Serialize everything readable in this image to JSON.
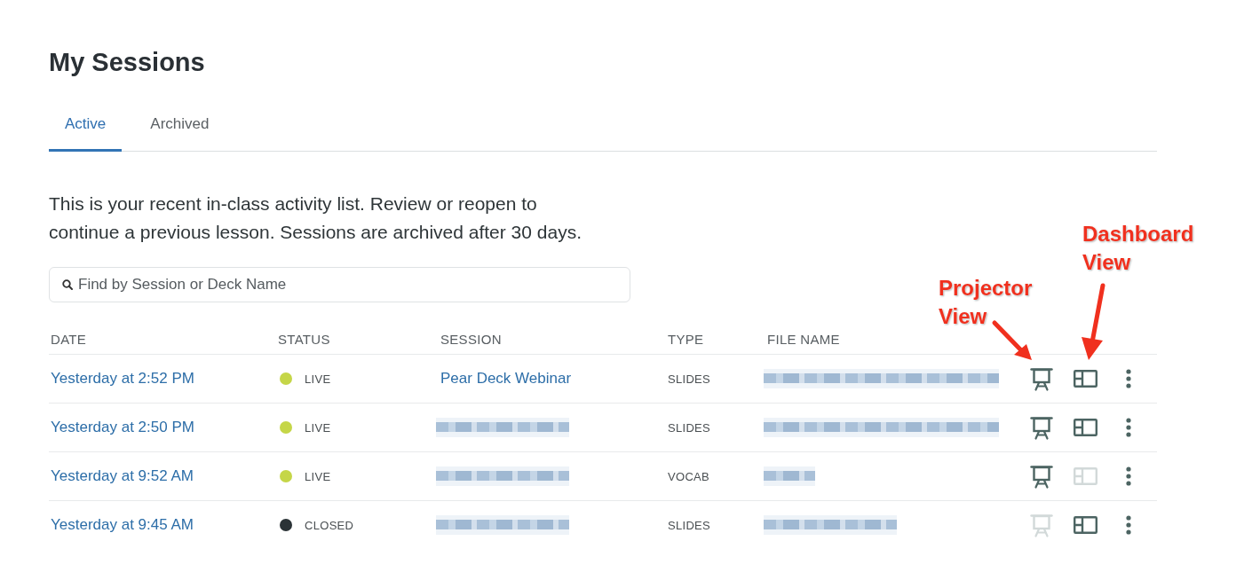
{
  "page": {
    "title": "My Sessions"
  },
  "tabs": [
    {
      "label": "Active",
      "selected": true
    },
    {
      "label": "Archived",
      "selected": false
    }
  ],
  "intro": "This is your recent in-class activity list. Review or reopen to continue a previous lesson. Sessions are archived after 30 days.",
  "search": {
    "placeholder": "Find by Session or Deck Name"
  },
  "table": {
    "columns": [
      "DATE",
      "STATUS",
      "SESSION",
      "TYPE",
      "FILE NAME"
    ],
    "rows": [
      {
        "date": "Yesterday at 2:52 PM",
        "status": {
          "label": "LIVE",
          "color": "#c5d648"
        },
        "session": {
          "kind": "link",
          "text": "Pear Deck Webinar"
        },
        "type": "SLIDES",
        "file_name": {
          "kind": "blurred_long"
        },
        "projector_view": {
          "disabled": false
        },
        "dashboard_view": {
          "disabled": false
        }
      },
      {
        "date": "Yesterday at 2:50 PM",
        "status": {
          "label": "LIVE",
          "color": "#c5d648"
        },
        "session": {
          "kind": "blurred_medium"
        },
        "type": "SLIDES",
        "file_name": {
          "kind": "blurred_long"
        },
        "projector_view": {
          "disabled": false
        },
        "dashboard_view": {
          "disabled": false
        }
      },
      {
        "date": "Yesterday at 9:52 AM",
        "status": {
          "label": "LIVE",
          "color": "#c5d648"
        },
        "session": {
          "kind": "blurred_medium"
        },
        "type": "VOCAB",
        "file_name": {
          "kind": "blurred_short"
        },
        "projector_view": {
          "disabled": false
        },
        "dashboard_view": {
          "disabled": true
        }
      },
      {
        "date": "Yesterday at 9:45 AM",
        "status": {
          "label": "CLOSED",
          "color": "#2b3337"
        },
        "session": {
          "kind": "blurred_medium"
        },
        "type": "SLIDES",
        "file_name": {
          "kind": "blurred_medium"
        },
        "projector_view": {
          "disabled": true
        },
        "dashboard_view": {
          "disabled": false
        }
      }
    ]
  },
  "annotations": [
    {
      "kind": "projector",
      "text": "Projector View"
    },
    {
      "kind": "dashboard",
      "text": "Dashboard View"
    }
  ]
}
